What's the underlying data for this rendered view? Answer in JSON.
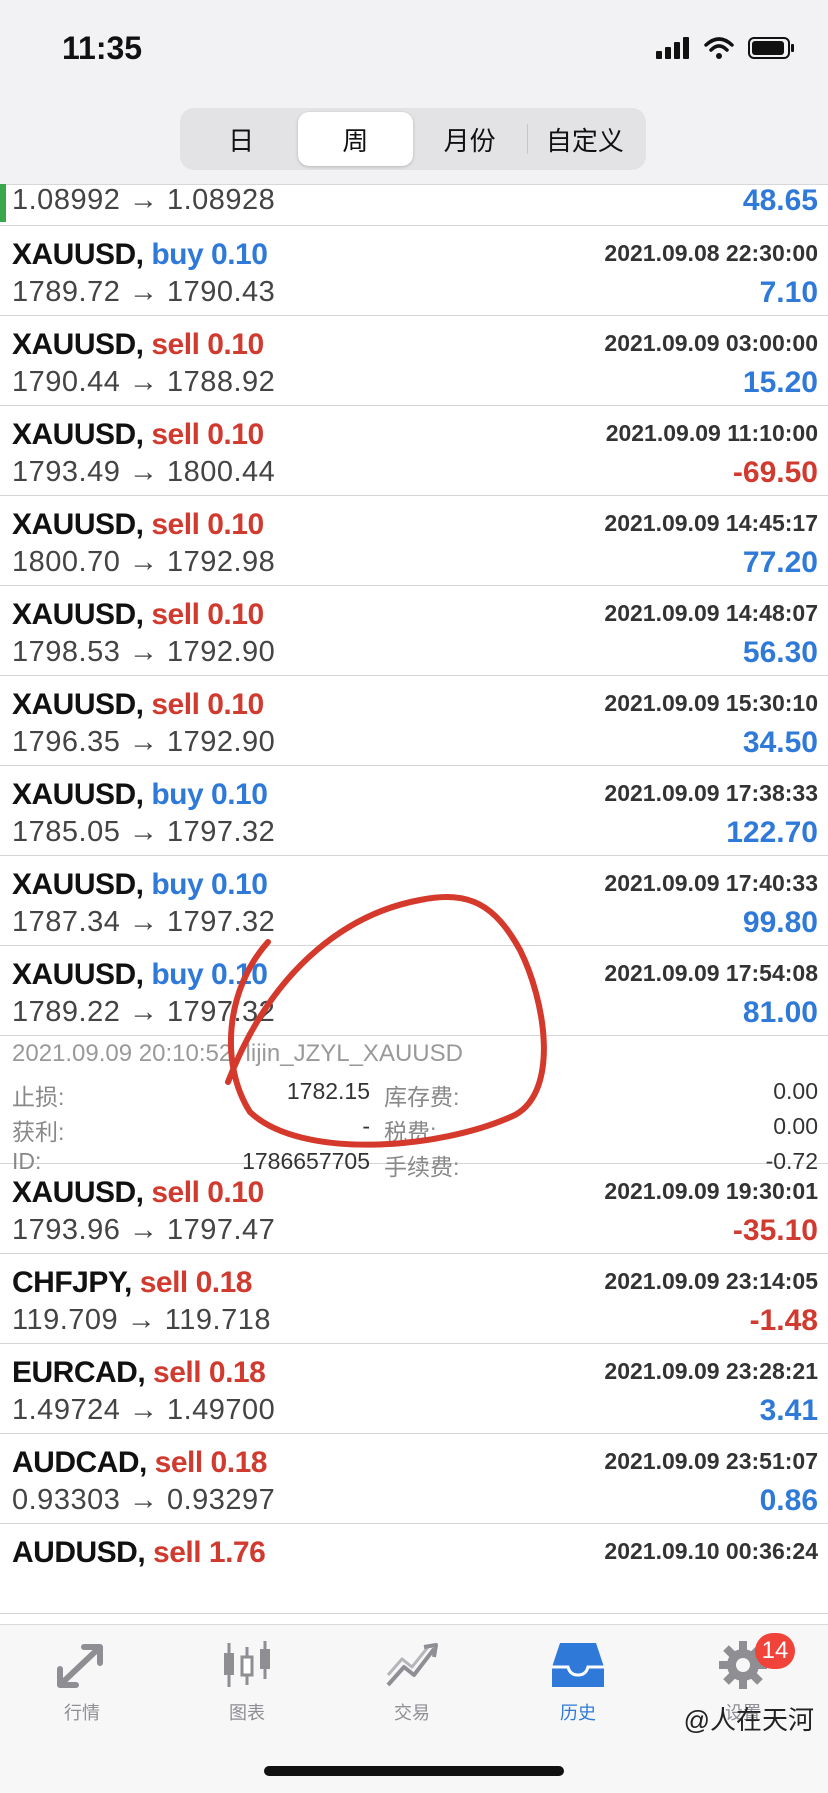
{
  "status": {
    "time": "11:35"
  },
  "tabs": [
    {
      "label": "日",
      "active": false
    },
    {
      "label": "周",
      "active": true
    },
    {
      "label": "月份",
      "active": false
    },
    {
      "label": "自定义",
      "active": false
    }
  ],
  "top_partial": {
    "prices": "1.08992 → 1.08928",
    "profit": "48.65"
  },
  "trades_a": [
    {
      "symbol": "XAUUSD,",
      "dir": "buy 0.10",
      "side": "buy",
      "time": "2021.09.08 22:30:00",
      "prices": "1789.72 → 1790.43",
      "profit": "7.10",
      "sign": "pos"
    },
    {
      "symbol": "XAUUSD,",
      "dir": "sell 0.10",
      "side": "sell",
      "time": "2021.09.09 03:00:00",
      "prices": "1790.44 → 1788.92",
      "profit": "15.20",
      "sign": "pos"
    },
    {
      "symbol": "XAUUSD,",
      "dir": "sell 0.10",
      "side": "sell",
      "time": "2021.09.09 11:10:00",
      "prices": "1793.49 → 1800.44",
      "profit": "-69.50",
      "sign": "neg"
    },
    {
      "symbol": "XAUUSD,",
      "dir": "sell 0.10",
      "side": "sell",
      "time": "2021.09.09 14:45:17",
      "prices": "1800.70 → 1792.98",
      "profit": "77.20",
      "sign": "pos"
    },
    {
      "symbol": "XAUUSD,",
      "dir": "sell 0.10",
      "side": "sell",
      "time": "2021.09.09 14:48:07",
      "prices": "1798.53 → 1792.90",
      "profit": "56.30",
      "sign": "pos"
    },
    {
      "symbol": "XAUUSD,",
      "dir": "sell 0.10",
      "side": "sell",
      "time": "2021.09.09 15:30:10",
      "prices": "1796.35 → 1792.90",
      "profit": "34.50",
      "sign": "pos"
    },
    {
      "symbol": "XAUUSD,",
      "dir": "buy 0.10",
      "side": "buy",
      "time": "2021.09.09 17:38:33",
      "prices": "1785.05 → 1797.32",
      "profit": "122.70",
      "sign": "pos"
    },
    {
      "symbol": "XAUUSD,",
      "dir": "buy 0.10",
      "side": "buy",
      "time": "2021.09.09 17:40:33",
      "prices": "1787.34 → 1797.32",
      "profit": "99.80",
      "sign": "pos"
    },
    {
      "symbol": "XAUUSD,",
      "dir": "buy 0.10",
      "side": "buy",
      "time": "2021.09.09 17:54:08",
      "prices": "1789.22 → 1797.32",
      "profit": "81.00",
      "sign": "pos"
    }
  ],
  "detail": {
    "meta": "2021.09.09 20:10:52, lijin_JZYL_XAUUSD",
    "sl_label": "止损:",
    "sl_value": "1782.15",
    "swap_label": "库存费:",
    "swap_value": "0.00",
    "tp_label": "获利:",
    "tp_value": "-",
    "tax_label": "税费:",
    "tax_value": "0.00",
    "id_label": "ID:",
    "id_value": "1786657705",
    "fee_label": "手续费:",
    "fee_value": "-0.72"
  },
  "trades_b": [
    {
      "symbol": "XAUUSD,",
      "dir": "sell 0.10",
      "side": "sell",
      "time": "2021.09.09 19:30:01",
      "prices": "1793.96 → 1797.47",
      "profit": "-35.10",
      "sign": "neg"
    },
    {
      "symbol": "CHFJPY,",
      "dir": "sell 0.18",
      "side": "sell",
      "time": "2021.09.09 23:14:05",
      "prices": "119.709 → 119.718",
      "profit": "-1.48",
      "sign": "neg"
    },
    {
      "symbol": "EURCAD,",
      "dir": "sell 0.18",
      "side": "sell",
      "time": "2021.09.09 23:28:21",
      "prices": "1.49724 → 1.49700",
      "profit": "3.41",
      "sign": "pos"
    },
    {
      "symbol": "AUDCAD,",
      "dir": "sell 0.18",
      "side": "sell",
      "time": "2021.09.09 23:51:07",
      "prices": "0.93303 → 0.93297",
      "profit": "0.86",
      "sign": "pos"
    },
    {
      "symbol": "AUDUSD,",
      "dir": "sell 1.76",
      "side": "sell",
      "time": "2021.09.10 00:36:24",
      "prices": "",
      "profit": "",
      "sign": "pos"
    }
  ],
  "bottom_tabs": [
    {
      "label": "行情",
      "icon": "quotes-arrows-icon"
    },
    {
      "label": "图表",
      "icon": "candlestick-chart-icon"
    },
    {
      "label": "交易",
      "icon": "trade-chart-icon"
    },
    {
      "label": "历史",
      "icon": "history-inbox-icon",
      "active": true
    },
    {
      "label": "设置",
      "icon": "gear-icon",
      "badge": "14"
    }
  ],
  "watermark": "@人在天河",
  "colors": {
    "buy": "#2f7ad8",
    "sell": "#d13b2f",
    "active_tab": "#2f7ad8",
    "badge": "#f0433a",
    "annotation": "#d4392b"
  }
}
